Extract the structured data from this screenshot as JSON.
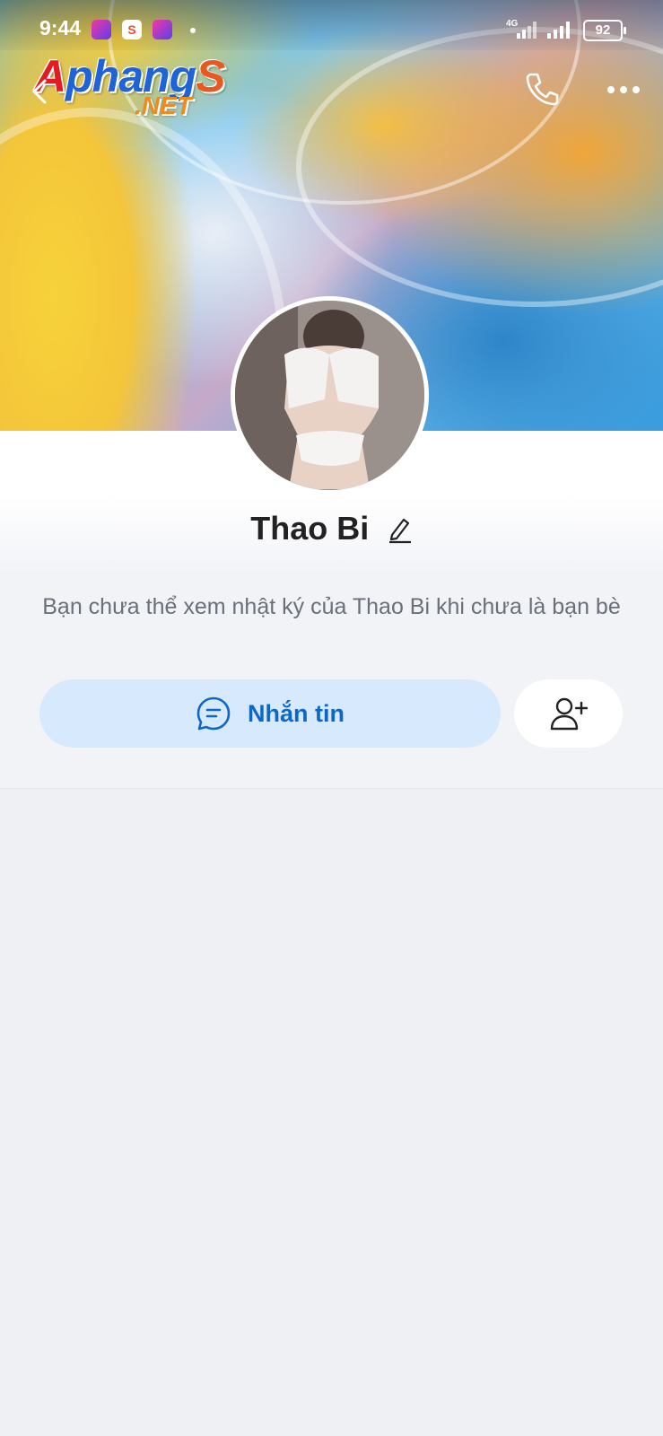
{
  "status_bar": {
    "time": "9:44",
    "network": "4G",
    "battery": "92",
    "notification_icons": [
      "lazada-icon",
      "shopee-icon",
      "lazada-icon"
    ],
    "shopee_glyph": "S",
    "lazada_glyph": "Laz"
  },
  "watermark": {
    "first_letter": "A",
    "middle_text": "phang",
    "last_letter": "S",
    "suffix": ".NET"
  },
  "header": {
    "icons": [
      "back-arrow-icon",
      "phone-icon",
      "more-dots-icon"
    ]
  },
  "profile": {
    "name": "Thao Bi",
    "notice": "Bạn chưa thể xem nhật ký của Thao Bi khi chưa là bạn bè"
  },
  "actions": {
    "message_label": "Nhắn tin",
    "message_icon": "chat-bubble-icon",
    "add_friend_icon": "add-friend-icon"
  },
  "colors": {
    "accent": "#0d67c9",
    "button_bg": "#d7e9fd",
    "page_bg": "#eff0f4"
  }
}
